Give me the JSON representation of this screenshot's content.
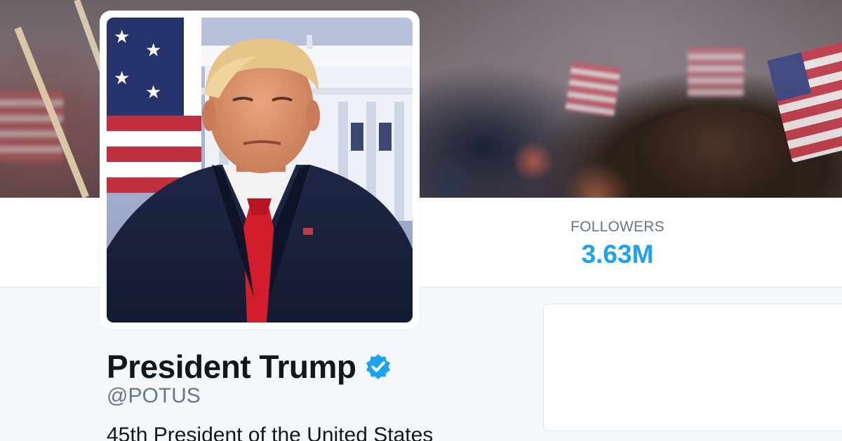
{
  "profile": {
    "name": "President Trump",
    "handle": "@POTUS",
    "bio": "45th President of the United States",
    "verified_icon": "verified-badge-icon"
  },
  "stats": {
    "followers_label": "FOLLOWERS",
    "followers_value": "3.63M"
  },
  "colors": {
    "accent": "#1da1f2",
    "verified": "#1da1f2",
    "text_primary": "#14171a",
    "text_secondary": "#657786",
    "background": "#f5f8fa"
  }
}
